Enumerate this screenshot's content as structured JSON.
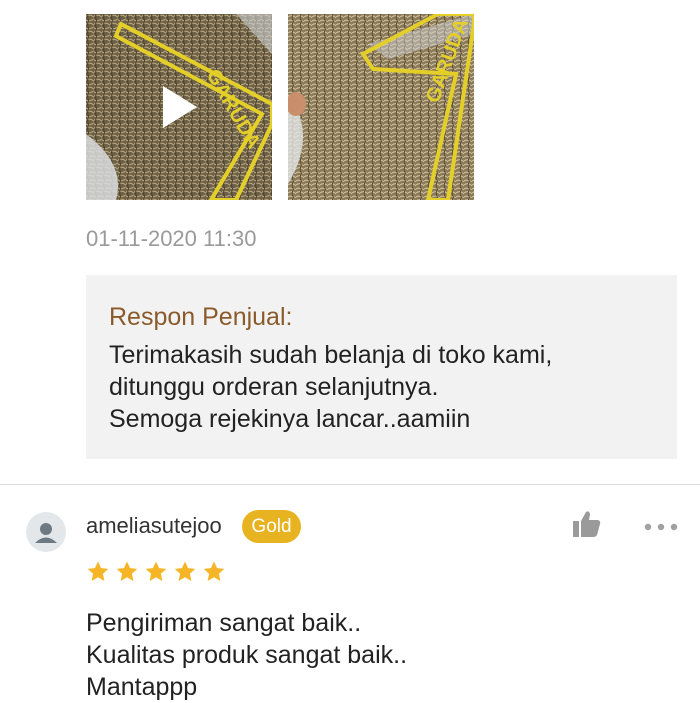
{
  "media": {
    "items": [
      {
        "kind": "video",
        "icon": "play-icon",
        "package_text": "GARUDA"
      },
      {
        "kind": "image",
        "package_text": "GARUDA"
      }
    ]
  },
  "review_prev": {
    "timestamp": "01-11-2020 11:30",
    "seller_reply": {
      "title": "Respon Penjual:",
      "lines": [
        "Terimakasih sudah belanja di toko kami,",
        "ditunggu orderan selanjutnya.",
        "Semoga rejekinya lancar..aamiin"
      ]
    }
  },
  "review": {
    "username": "ameliasutejoo",
    "badge": "Gold",
    "rating": 5,
    "rating_max": 5,
    "lines": [
      "Pengiriman sangat baik..",
      "Kualitas produk sangat baik..",
      "Mantappp"
    ],
    "icons": {
      "like": "thumbs-up-icon",
      "more": "more-dots-icon",
      "avatar": "user-avatar-icon"
    }
  },
  "colors": {
    "badge": "#e8b321",
    "star": "#f5b526",
    "reply_title": "#8b5a2b",
    "reply_bg": "#f2f2f2",
    "package_yellow": "#e3cf27"
  }
}
